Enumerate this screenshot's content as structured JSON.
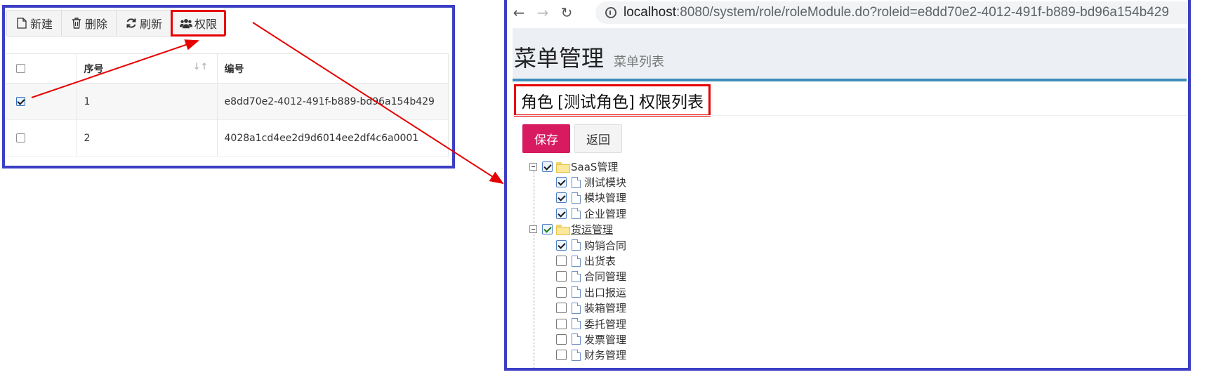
{
  "left": {
    "toolbar": [
      {
        "label": "新建",
        "icon": "file-icon"
      },
      {
        "label": "删除",
        "icon": "trash-icon"
      },
      {
        "label": "刷新",
        "icon": "refresh-icon"
      },
      {
        "label": "权限",
        "icon": "users-icon"
      }
    ],
    "columns": [
      "序号",
      "编号"
    ],
    "rows": [
      {
        "seq": "1",
        "id": "e8dd70e2-4012-491f-b889-bd96a154b429",
        "checked": true
      },
      {
        "seq": "2",
        "id": "4028a1cd4ee2d9d6014ee2df4c6a0001",
        "checked": false
      }
    ]
  },
  "right": {
    "url": {
      "host": "localhost",
      "path": ":8080/system/role/roleModule.do?roleid=e8dd70e2-4012-491f-b889-bd96a154b429"
    },
    "page_title": "菜单管理",
    "page_subtitle": "菜单列表",
    "box_title": {
      "prefix": "角色",
      "role": "[测试角色]",
      "suffix": "权限列表"
    },
    "save_label": "保存",
    "back_label": "返回",
    "tree": [
      {
        "label": "SaaS管理",
        "type": "folder",
        "level": 0,
        "checked": true
      },
      {
        "label": "测试模块",
        "type": "file",
        "level": 1,
        "checked": true
      },
      {
        "label": "模块管理",
        "type": "file",
        "level": 1,
        "checked": true
      },
      {
        "label": "企业管理",
        "type": "file",
        "level": 1,
        "checked": true
      },
      {
        "label": "货运管理",
        "type": "folder",
        "level": 0,
        "checked": "partial"
      },
      {
        "label": "购销合同",
        "type": "file",
        "level": 1,
        "checked": true
      },
      {
        "label": "出货表",
        "type": "file",
        "level": 1,
        "checked": false
      },
      {
        "label": "合同管理",
        "type": "file",
        "level": 1,
        "checked": false
      },
      {
        "label": "出口报运",
        "type": "file",
        "level": 1,
        "checked": false
      },
      {
        "label": "装箱管理",
        "type": "file",
        "level": 1,
        "checked": false
      },
      {
        "label": "委托管理",
        "type": "file",
        "level": 1,
        "checked": false
      },
      {
        "label": "发票管理",
        "type": "file",
        "level": 1,
        "checked": false
      },
      {
        "label": "财务管理",
        "type": "file",
        "level": 1,
        "checked": false
      }
    ]
  },
  "colors": {
    "panel_border": "#3c3fc4",
    "highlight": "#e60000",
    "save_button": "#d81b60",
    "header_rule": "#3c8dbc"
  }
}
